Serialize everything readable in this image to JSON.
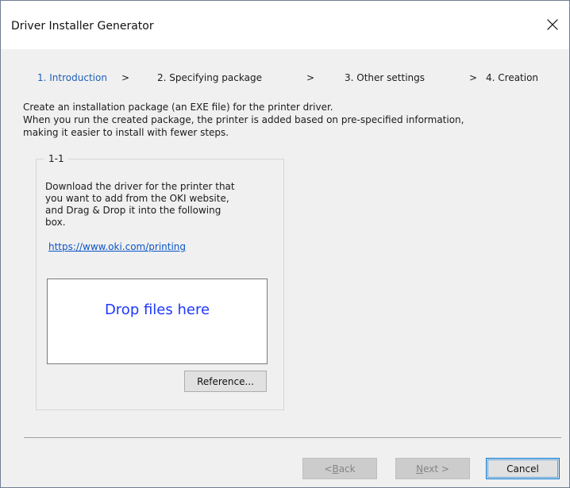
{
  "window": {
    "title": "Driver Installer Generator",
    "close_icon": "close-icon"
  },
  "steps": [
    {
      "label": "1. Introduction",
      "active": true
    },
    {
      "label": ">",
      "active": false
    },
    {
      "label": "2. Specifying package",
      "active": false
    },
    {
      "label": ">",
      "active": false
    },
    {
      "label": "3. Other settings",
      "active": false
    },
    {
      "label": ">",
      "active": false
    },
    {
      "label": "4. Creation",
      "active": false
    }
  ],
  "description": {
    "lines": [
      "Create an installation package (an EXE file) for the printer driver.",
      "When you run the created package, the printer is added based on pre-specified information,",
      "making it easier to install with fewer steps."
    ]
  },
  "group": {
    "label": "1-1",
    "instruction_lines": [
      "Download the driver for the printer that",
      "you want to add from the OKI website,",
      "and Drag & Drop it into the following",
      "box."
    ],
    "link": "https://www.oki.com/printing",
    "drop_text": "Drop files here",
    "reference_label": "Reference..."
  },
  "buttons": {
    "back_prefix": "< ",
    "back_mnemonic": "B",
    "back_suffix": "ack",
    "next_mnemonic": "N",
    "next_suffix": "ext >",
    "cancel_label": "Cancel",
    "back_enabled": false,
    "next_enabled": false
  },
  "colors": {
    "active_step": "#1f5fb8",
    "link": "#0b54c7",
    "drop_text": "#1f37ff",
    "focus_border": "#0078d7",
    "window_background": "#f0f0f0",
    "title_background": "#ffffff"
  }
}
